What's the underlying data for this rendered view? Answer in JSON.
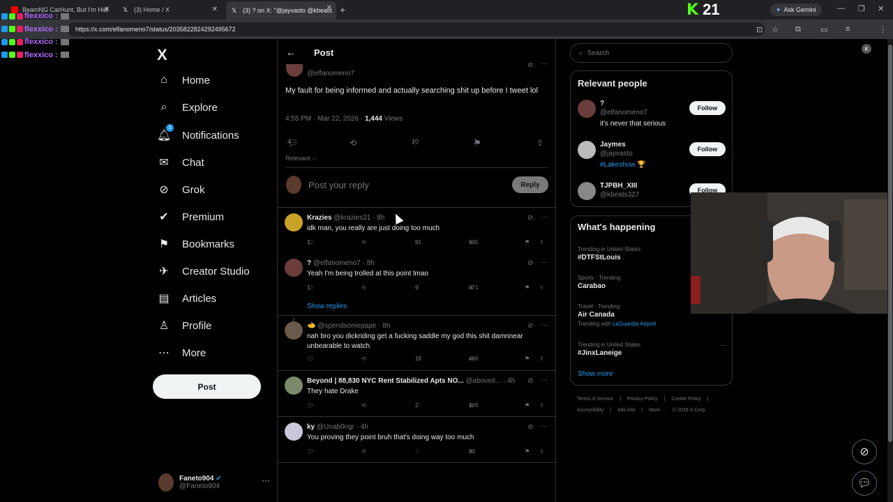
{
  "browser": {
    "tabs": [
      {
        "label": "BeamNG CarHunt, But I'm Hidi",
        "color": "#ff0000"
      },
      {
        "label": "(3) Home / X",
        "color": "#ffffff"
      },
      {
        "label": "(3) ? on X: \"@jayvasto @kbeats",
        "color": "#ffffff"
      }
    ],
    "url": "https://x.com/elfanomeno7/status/2035822824292495672",
    "kick_logo": "K",
    "kick_count": "21",
    "ask_gemini": "Ask Gemini",
    "profile_initial": "K"
  },
  "chat": {
    "lines": [
      "flexxico :",
      "flexxico :",
      "flexxico :",
      "flexxico :"
    ]
  },
  "nav": {
    "logo": "X",
    "items": [
      {
        "label": "Home",
        "icon": "⌂"
      },
      {
        "label": "Explore",
        "icon": "⌕"
      },
      {
        "label": "Notifications",
        "icon": "🔔︎"
      },
      {
        "label": "Chat",
        "icon": "✉"
      },
      {
        "label": "Grok",
        "icon": "⊘"
      },
      {
        "label": "Premium",
        "icon": "✔"
      },
      {
        "label": "Bookmarks",
        "icon": "⚑"
      },
      {
        "label": "Creator Studio",
        "icon": "✈"
      },
      {
        "label": "Articles",
        "icon": "▤"
      },
      {
        "label": "Profile",
        "icon": "♙"
      },
      {
        "label": "More",
        "icon": "⋯"
      }
    ],
    "notif_count": "3",
    "post_button": "Post",
    "me_name": "Faneto904",
    "me_handle": "@Faneto904",
    "me_more": "···"
  },
  "main": {
    "header": "Post",
    "back_icon": "←",
    "op": {
      "handle": "@elfanomeno7",
      "text": "My fault for being informed and actually searching shit up before I tweet lol",
      "time": "4:55 PM · Mar 22, 2026 · ",
      "views_num": "1,444",
      "views_label": " Views",
      "replies": "4",
      "likes": "10",
      "bookmarks": "1"
    },
    "sort": "Relevant ⌵",
    "reply_placeholder": "Post your reply",
    "reply_button": "Reply",
    "show_replies": "Show replies",
    "replies": [
      {
        "name": "Krazies",
        "meta": " @krazies21 · 8h",
        "text": "idk man, you really are just doing too much",
        "replies": "1",
        "likes": "81",
        "views": "630",
        "color": "#c9a227"
      },
      {
        "name": "?",
        "meta": " @elfanomeno7 · 8h",
        "text": "Yeah I'm being trolled at this point lmao",
        "replies": "1",
        "likes": "9",
        "views": "671",
        "color": "#6b3d3d"
      },
      {
        "name": "🫲",
        "meta": " @spendsomepape · 8h",
        "text": "nah bro you dickriding get a fucking saddle my god this shit damnnear unbearable to watch",
        "replies": "",
        "likes": "18",
        "views": "486",
        "color": "#6a5a4a"
      },
      {
        "name": "Beyond | 88,830 NYC Rent Stabilized Apts NO...",
        "meta": " @aboveit... · 4h",
        "text": "They hate Drake",
        "replies": "",
        "likes": "2",
        "views": "128",
        "color": "#7b8a6a"
      },
      {
        "name": "ky",
        "meta": " @Unab0ngr · 4h",
        "text": "You proving they point bruh that's doing way too much",
        "replies": "",
        "likes": "",
        "views": "93",
        "color": "#c8c8d8"
      }
    ]
  },
  "sidebar": {
    "search_placeholder": "Search",
    "relevant_title": "Relevant people",
    "people": [
      {
        "name": "?",
        "handle": "@elfanomeno7",
        "bio": "it's never that serious",
        "bio_link": "",
        "bio_tail": "",
        "follow": "Follow",
        "color": "#6b3d3d"
      },
      {
        "name": "Jaymes",
        "handle": "@jayvasto",
        "bio": "",
        "bio_link": "#Lakeshow",
        "bio_tail": " 🏆",
        "follow": "Follow",
        "color": "#bbbbbb"
      },
      {
        "name": "TJPBH_XIII",
        "handle": "@kbeats327",
        "bio": "",
        "bio_link": "",
        "bio_tail": "",
        "follow": "Follow",
        "color": "#888888"
      }
    ],
    "happening_title": "What's happening",
    "trends": [
      {
        "cat": "Trending in United States",
        "title": "#DTFStLouis",
        "with_label": "",
        "with_link": ""
      },
      {
        "cat": "Sports · Trending",
        "title": "Carabao",
        "with_label": "",
        "with_link": ""
      },
      {
        "cat": "Travel · Trending",
        "title": "Air Canada",
        "with_label": "Trending with ",
        "with_link": "LaGuardia Airport"
      },
      {
        "cat": "Trending in United States",
        "title": "#JinxLaneige",
        "with_label": "",
        "with_link": ""
      }
    ],
    "show_more": "Show more",
    "footer": [
      "Terms of Service",
      "|",
      "Privacy Policy",
      "|",
      "Cookie Policy",
      "|",
      "Accessibility",
      "|",
      "Ads info",
      "|",
      "More ···",
      "© 2026 X Corp."
    ]
  }
}
